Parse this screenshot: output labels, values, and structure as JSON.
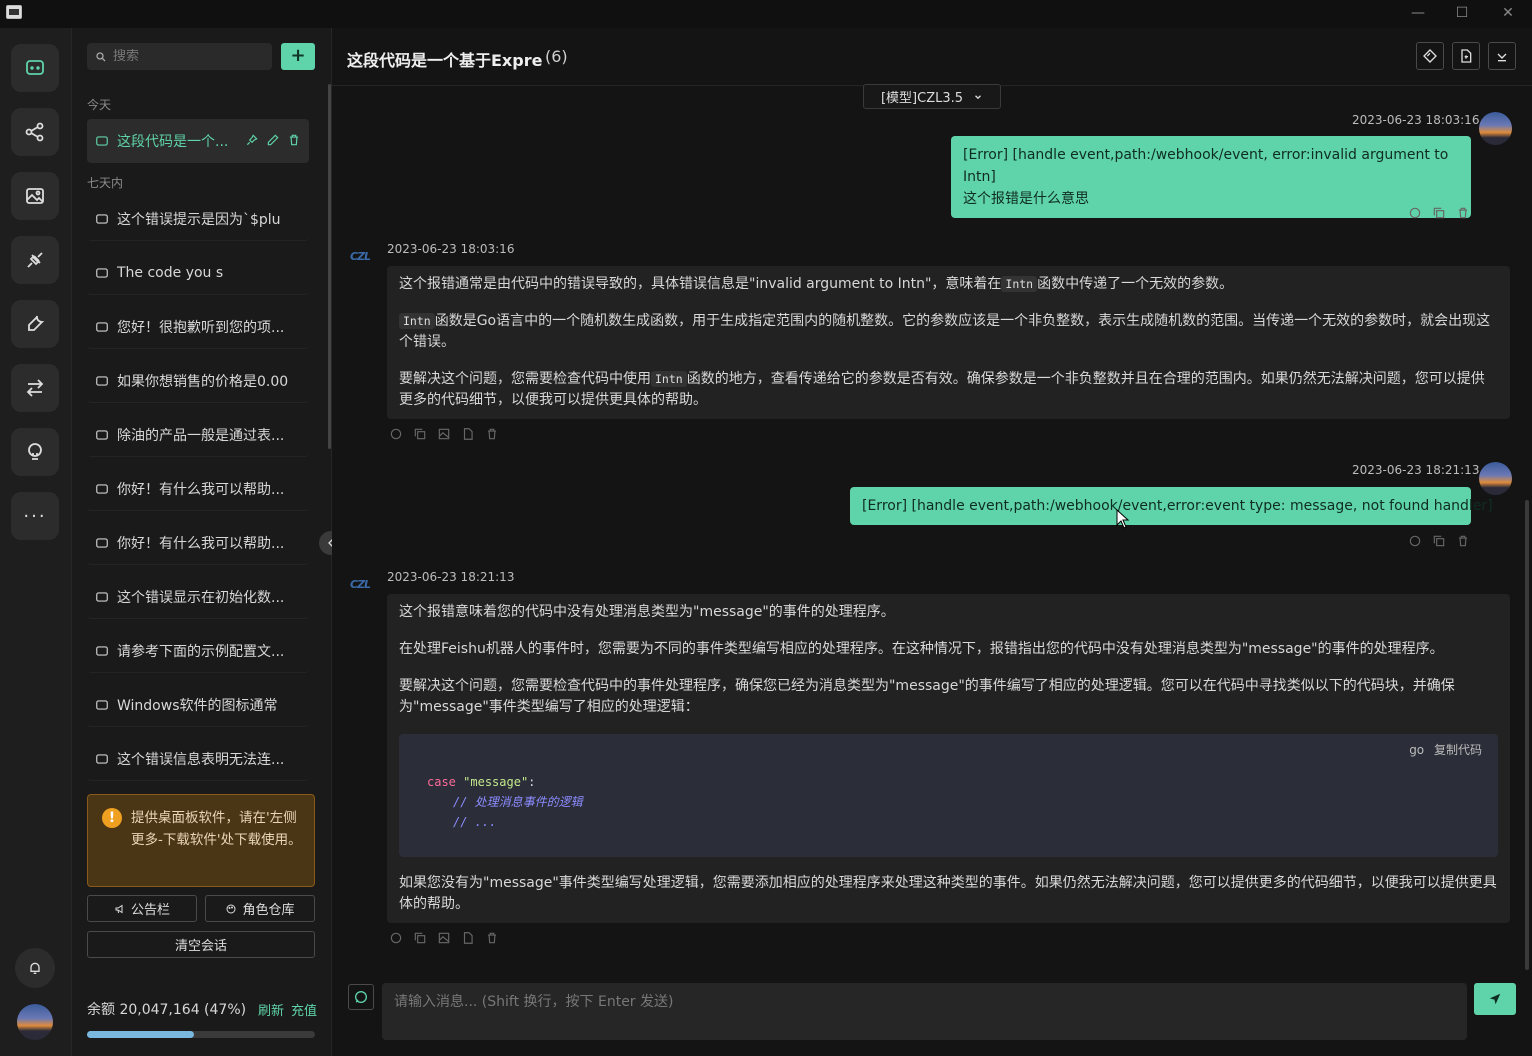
{
  "titlebar": {
    "minimize": "—",
    "maximize": "☐",
    "close": "✕"
  },
  "rail": {
    "items": [
      "chat-icon",
      "share-nodes-icon",
      "image-icon",
      "plugin-icon",
      "wrench-icon",
      "swap-icon",
      "bulb-icon",
      "more-icon"
    ],
    "more_label": "···"
  },
  "sidebar": {
    "search_placeholder": "搜索",
    "add_label": "+",
    "group_today": "今天",
    "group_week": "七天内",
    "active_session": "这段代码是一个...",
    "sessions": [
      "这个错误提示是因为`$plu",
      "The code you s",
      "您好！很抱歉听到您的项...",
      "如果你想销售的价格是0.00",
      "除油的产品一般是通过表...",
      "你好！有什么我可以帮助...",
      "你好！有什么我可以帮助...",
      "这个错误显示在初始化数...",
      "请参考下面的示例配置文...",
      "Windows软件的图标通常",
      "这个错误信息表明无法连..."
    ],
    "notice_icon": "!",
    "notice": "提供桌面板软件，请在'左侧更多-下载软件'处下载使用。",
    "announcement": "公告栏",
    "role_repo": "角色仓库",
    "clear": "清空会话",
    "balance": "余额 20,047,164 (47%)",
    "refresh": "刷新",
    "recharge": "充值",
    "balance_percent": 47
  },
  "main": {
    "title": "这段代码是一个基于Expre",
    "count": "(6)",
    "model": "[模型]CZL3.5",
    "bot_name": "CZL",
    "messages": {
      "u1_time": "2023-06-23 18:03:16",
      "u1_line1": "[Error] [handle event,path:/webhook/event, error:invalid argument to Intn]",
      "u1_line2": "这个报错是什么意思",
      "b1_time": "2023-06-23 18:03:16",
      "b1_p1_a": "这个报错通常是由代码中的错误导致的，具体错误信息是\"invalid argument to Intn\"，意味着在",
      "b1_p1_code": "Intn",
      "b1_p1_b": "函数中传递了一个无效的参数。",
      "b1_p2_code": "Intn",
      "b1_p2_b": "函数是Go语言中的一个随机数生成函数，用于生成指定范围内的随机整数。它的参数应该是一个非负整数，表示生成随机数的范围。当传递一个无效的参数时，就会出现这个错误。",
      "b1_p3_a": "要解决这个问题，您需要检查代码中使用",
      "b1_p3_code": "Intn",
      "b1_p3_b": "函数的地方，查看传递给它的参数是否有效。确保参数是一个非负整数并且在合理的范围内。如果仍然无法解决问题，您可以提供更多的代码细节，以便我可以提供更具体的帮助。",
      "u2_time": "2023-06-23 18:21:13",
      "u2_text": "[Error] [handle event,path:/webhook/event,error:event type: message, not found handler]",
      "b2_time": "2023-06-23 18:21:13",
      "b2_p1": "这个报错意味着您的代码中没有处理消息类型为\"message\"的事件的处理程序。",
      "b2_p2": "在处理Feishu机器人的事件时，您需要为不同的事件类型编写相应的处理程序。在这种情况下，报错指出您的代码中没有处理消息类型为\"message\"的事件的处理程序。",
      "b2_p3": "要解决这个问题，您需要检查代码中的事件处理程序，确保您已经为消息类型为\"message\"的事件编写了相应的处理逻辑。您可以在代码中寻找类似以下的代码块，并确保为\"message\"事件类型编写了相应的处理逻辑：",
      "code_lang": "go",
      "code_copy": "复制代码",
      "code_kw": "case",
      "code_str": "\"message\"",
      "code_colon": ":",
      "code_cm1": "// 处理消息事件的逻辑",
      "code_cm2": "// ...",
      "b2_p4": "如果您没有为\"message\"事件类型编写处理逻辑，您需要添加相应的处理程序来处理这种类型的事件。如果仍然无法解决问题，您可以提供更多的代码细节，以便我可以提供更具体的帮助。"
    },
    "input_placeholder": "请输入消息... (Shift 换行，按下 Enter 发送)"
  },
  "colors": {
    "accent": "#5fd3a9",
    "bg": "#141414",
    "panel": "#1a1a1a",
    "notice_bg": "#4a3514"
  }
}
